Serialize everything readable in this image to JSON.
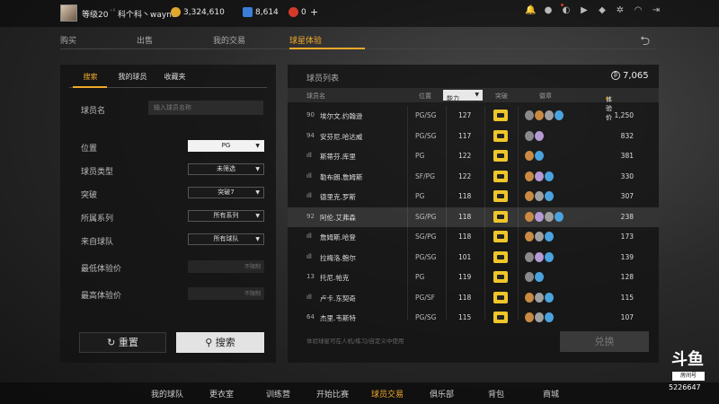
{
  "topbar": {
    "level": "等级20",
    "username": "科个科丶wayne",
    "coins": "3,324,610",
    "points": "8,614",
    "tickets": "0",
    "plus": "+"
  },
  "subnav": [
    "购买",
    "出售",
    "我的交易",
    "球星体验"
  ],
  "left": {
    "tabs": [
      "搜索",
      "我的球员",
      "收藏夹"
    ],
    "name_label": "球员名",
    "name_placeholder": "输入球员名称",
    "filters": [
      {
        "label": "位置",
        "value": "PG"
      },
      {
        "label": "球员类型",
        "value": "未筛选"
      },
      {
        "label": "突破",
        "value": "突破7"
      },
      {
        "label": "所属系列",
        "value": "所有系列"
      },
      {
        "label": "来自球队",
        "value": "所有球队"
      }
    ],
    "min_price_label": "最低体验价",
    "max_price_label": "最高体验价",
    "price_placeholder": "不限制",
    "reset_label": "重置",
    "search_label": "搜索"
  },
  "right": {
    "title": "球员列表",
    "coins": "7,065",
    "headers": {
      "name": "球员名",
      "pos": "位置",
      "ability": "能力",
      "breakthrough": "突破",
      "chips": "徽章",
      "price": "体验价"
    },
    "players": [
      {
        "ovr": "90",
        "name": "埃尔文.约翰逊",
        "pos": "PG/SG",
        "ability": "127",
        "price": "1,250",
        "chips": [
          "#8a8a8a",
          "#c98a44",
          "#a0a0a0",
          "#4aa3df"
        ]
      },
      {
        "ovr": "94",
        "name": "安芬尼.哈达威",
        "pos": "PG/SG",
        "ability": "117",
        "price": "832",
        "chips": [
          "#8a8a8a",
          "#b59ad4"
        ]
      },
      {
        "ovr": "",
        "name": "斯蒂芬.库里",
        "pos": "PG",
        "ability": "122",
        "price": "381",
        "chips": [
          "#c98a44",
          "#4aa3df"
        ]
      },
      {
        "ovr": "",
        "name": "勒布朗.詹姆斯",
        "pos": "SF/PG",
        "ability": "122",
        "price": "330",
        "chips": [
          "#c98a44",
          "#b59ad4",
          "#4aa3df"
        ]
      },
      {
        "ovr": "",
        "name": "德里克.罗斯",
        "pos": "PG",
        "ability": "118",
        "price": "307",
        "chips": [
          "#c98a44",
          "#a0a0a0",
          "#4aa3df"
        ]
      },
      {
        "ovr": "92",
        "name": "阿伦.艾弗森",
        "pos": "SG/PG",
        "ability": "118",
        "price": "238",
        "chips": [
          "#c98a44",
          "#b59ad4",
          "#a0a0a0",
          "#4aa3df"
        ]
      },
      {
        "ovr": "",
        "name": "詹姆斯.哈登",
        "pos": "SG/PG",
        "ability": "118",
        "price": "173",
        "chips": [
          "#c98a44",
          "#a0a0a0",
          "#4aa3df"
        ]
      },
      {
        "ovr": "",
        "name": "拉梅洛.鲍尔",
        "pos": "PG/SG",
        "ability": "101",
        "price": "139",
        "chips": [
          "#8a8a8a",
          "#b59ad4",
          "#4aa3df"
        ]
      },
      {
        "ovr": "13",
        "name": "托尼.帕克",
        "pos": "PG",
        "ability": "119",
        "price": "128",
        "chips": [
          "#8a8a8a",
          "#4aa3df"
        ]
      },
      {
        "ovr": "",
        "name": "卢卡.东契奇",
        "pos": "PG/SF",
        "ability": "118",
        "price": "115",
        "chips": [
          "#c98a44",
          "#a0a0a0",
          "#4aa3df"
        ]
      },
      {
        "ovr": "64",
        "name": "杰里.韦斯特",
        "pos": "PG/SG",
        "ability": "115",
        "price": "107",
        "chips": [
          "#c98a44",
          "#a0a0a0",
          "#4aa3df"
        ]
      }
    ],
    "note": "体验球星可在人机/练习/自定义中使用",
    "exchange_label": "兑换"
  },
  "bottomnav": [
    {
      "label": "我的球队",
      "active": false
    },
    {
      "label": "更衣室",
      "active": false
    },
    {
      "label": "训练营",
      "active": false
    },
    {
      "label": "开始比赛",
      "active": false
    },
    {
      "label": "球员交易",
      "active": true
    },
    {
      "label": "俱乐部",
      "active": false
    },
    {
      "label": "背包",
      "active": false
    },
    {
      "label": "商城",
      "active": false
    }
  ],
  "watermark": {
    "logo": "斗鱼",
    "sub": "房间号",
    "room": "5226647"
  },
  "colors": {
    "accent": "#f0a92a",
    "badge": "#efc62a"
  }
}
